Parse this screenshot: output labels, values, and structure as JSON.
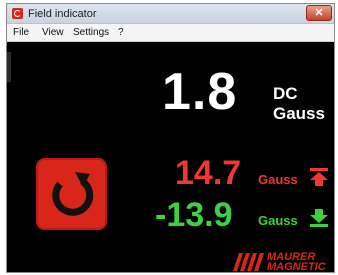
{
  "window": {
    "title": "Field indicator",
    "close_label": "✕"
  },
  "menu": {
    "items": [
      "File",
      "View",
      "Settings",
      "?"
    ]
  },
  "reading": {
    "value": "1.8",
    "mode": "DC",
    "unit": "Gauss"
  },
  "max": {
    "value": "14.7",
    "unit": "Gauss",
    "icon": "max-arrow-up-icon",
    "color": "#f0392c"
  },
  "min": {
    "value": "-13.9",
    "unit": "Gauss",
    "icon": "min-arrow-down-icon",
    "color": "#3bd23e"
  },
  "reset": {
    "icon": "reset-refresh-icon",
    "color": "#d8261a"
  },
  "logo": {
    "line1": "MAURER",
    "line2": "MAGNETIC",
    "color": "#d8261a"
  }
}
